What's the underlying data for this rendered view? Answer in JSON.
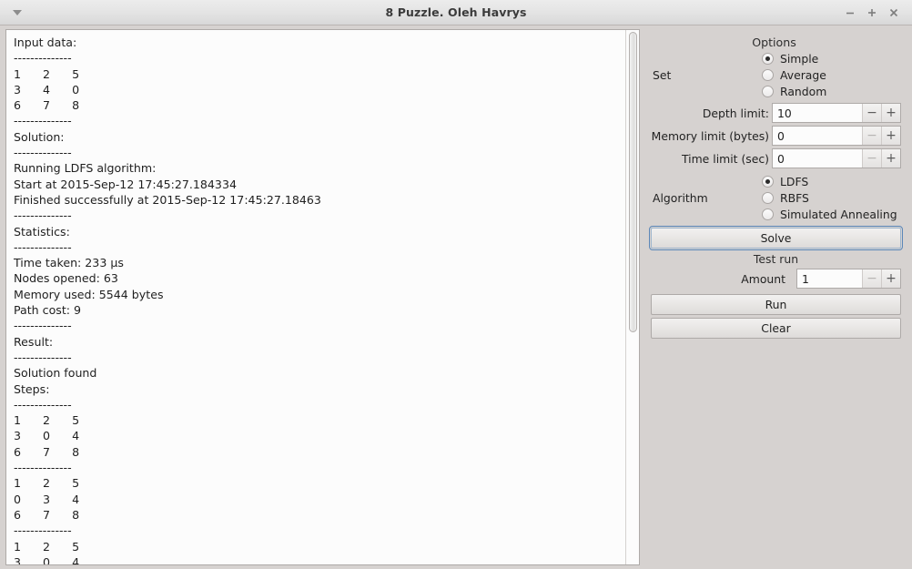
{
  "titlebar": {
    "title": "8 Puzzle. Oleh Havrys",
    "menu_icon": "chevron-down-icon",
    "minimize_label": "−",
    "maximize_label": "+",
    "close_label": "×"
  },
  "log": {
    "text": "Input data:\n--------------\n1\t2\t5\n3\t4\t0\n6\t7\t8\n--------------\nSolution:\n--------------\nRunning LDFS algorithm:\nStart at 2015-Sep-12 17:45:27.184334\nFinished successfully at 2015-Sep-12 17:45:27.18463\n--------------\nStatistics:\n--------------\nTime taken: 233 µs\nNodes opened: 63\nMemory used: 5544 bytes\nPath cost: 9\n--------------\nResult:\n--------------\nSolution found\nSteps:\n--------------\n1\t2\t5\n3\t0\t4\n6\t7\t8\n--------------\n1\t2\t5\n0\t3\t4\n6\t7\t8\n--------------\n1\t2\t5\n3\t0\t4\n"
  },
  "panel": {
    "title": "Options",
    "set": {
      "label": "Set",
      "options": [
        {
          "label": "Simple",
          "checked": true
        },
        {
          "label": "Average",
          "checked": false
        },
        {
          "label": "Random",
          "checked": false
        }
      ]
    },
    "spinners": [
      {
        "label": "Depth limit:",
        "value": "10",
        "minus_disabled": false
      },
      {
        "label": "Memory limit (bytes)",
        "value": "0",
        "minus_disabled": true
      },
      {
        "label": "Time limit (sec)",
        "value": "0",
        "minus_disabled": true
      }
    ],
    "algorithm": {
      "label": "Algorithm",
      "options": [
        {
          "label": "LDFS",
          "checked": true
        },
        {
          "label": "RBFS",
          "checked": false
        },
        {
          "label": "Simulated Annealing",
          "checked": false
        }
      ]
    },
    "solve_label": "Solve",
    "test_run_label": "Test run",
    "amount": {
      "label": "Amount",
      "value": "1",
      "minus_disabled": true
    },
    "run_label": "Run",
    "clear_label": "Clear",
    "minus_glyph": "−",
    "plus_glyph": "+"
  },
  "colors": {
    "window_bg": "#d6d2d0",
    "text_bg": "#fcfcfc",
    "focus_blue": "#5b87b8",
    "border": "#aeaaa8"
  }
}
